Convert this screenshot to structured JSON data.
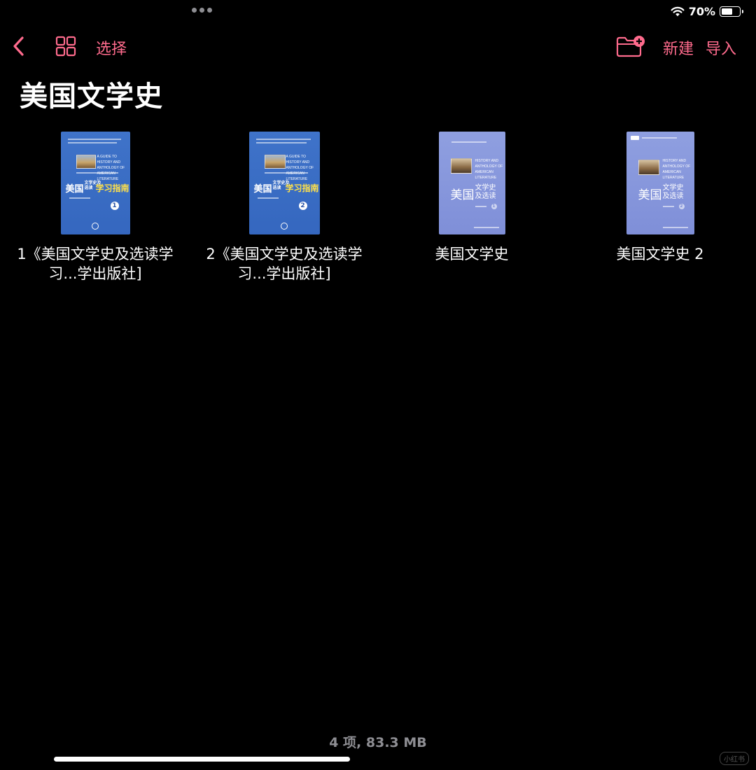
{
  "status_bar": {
    "battery_text": "70%",
    "battery_level": 0.7,
    "icons": [
      "multitasking-dots-icon",
      "wifi-icon",
      "battery-icon"
    ]
  },
  "toolbar": {
    "back_icon": "chevron-left-icon",
    "grid_icon": "grid-view-icon",
    "select_label": "选择",
    "new_folder_icon": "folder-plus-icon",
    "new_label": "新建",
    "import_label": "导入"
  },
  "page": {
    "title": "美国文学史"
  },
  "files": [
    {
      "name": "1《美国文学史及选读学习...学出版社]",
      "cover": {
        "style": "dark",
        "english_title": "A GUIDE TO HISTORY AND ANTHOLOGY OF AMERICAN LITERATURE",
        "title_cn": "美国",
        "title_cn_small": "文学史及选读",
        "title_yellow": "学习指南",
        "volume": "1"
      }
    },
    {
      "name": "2《美国文学史及选读学习...学出版社]",
      "cover": {
        "style": "dark",
        "english_title": "A GUIDE TO HISTORY AND ANTHOLOGY OF AMERICAN LITERATURE",
        "title_cn": "美国",
        "title_cn_small": "文学史及选读",
        "title_yellow": "学习指南",
        "volume": "2"
      }
    },
    {
      "name": "美国文学史",
      "cover": {
        "style": "light",
        "english_title": "HISTORY AND ANTHOLOGY OF AMERICAN LITERATURE",
        "title_cn": "美国",
        "title_cn_small": "文学史及选读",
        "volume": "1"
      }
    },
    {
      "name": "美国文学史 2",
      "cover": {
        "style": "light",
        "english_title": "HISTORY AND ANTHOLOGY OF AMERICAN LITERATURE",
        "title_cn": "美国",
        "title_cn_small": "文学史及选读",
        "volume": "2"
      }
    }
  ],
  "footer": {
    "summary": "4 项, 83.3 MB"
  },
  "watermark": "小红书",
  "colors": {
    "accent": "#ff6b8d",
    "background": "#000000",
    "cover_dark": "#3f73c9",
    "cover_light": "#8f9fe0",
    "cover_yellow_text": "#ffe14a"
  }
}
